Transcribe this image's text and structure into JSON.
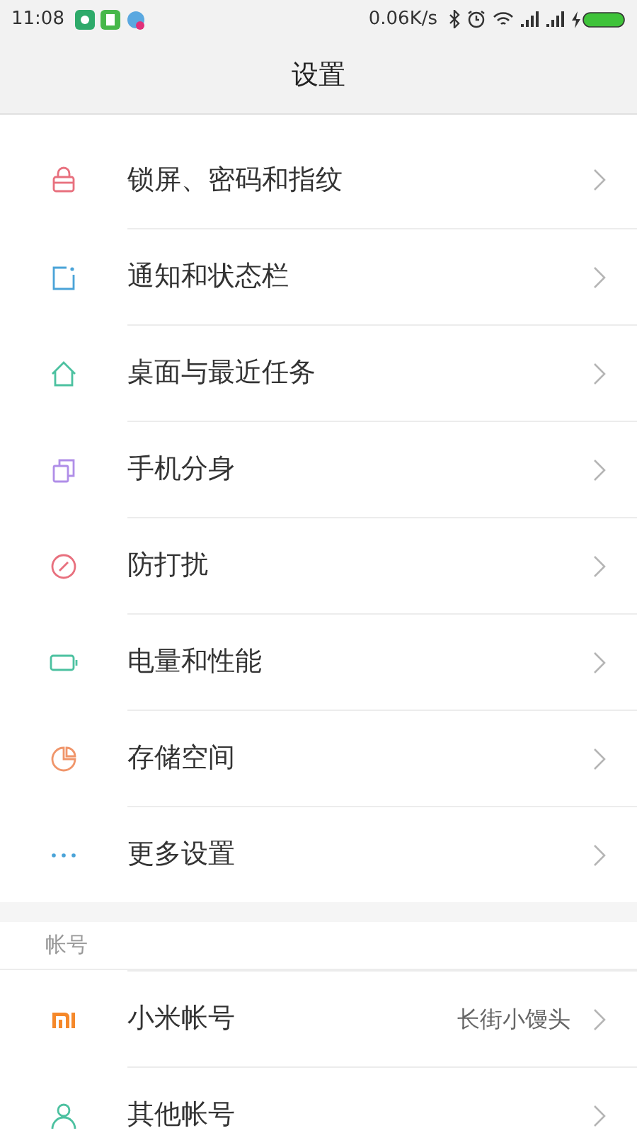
{
  "status_bar": {
    "time": "11:08",
    "speed": "0.06K/s"
  },
  "title": "设置",
  "sections": [
    {
      "items": [
        {
          "kind": "lock",
          "color": "#e8707e",
          "label": "锁屏、密码和指纹"
        },
        {
          "kind": "notify",
          "color": "#4aa3d8",
          "label": "通知和状态栏"
        },
        {
          "kind": "home",
          "color": "#4cc1a0",
          "label": "桌面与最近任务"
        },
        {
          "kind": "clone",
          "color": "#b08ee8",
          "label": "手机分身"
        },
        {
          "kind": "dnd",
          "color": "#e8707e",
          "label": "防打扰"
        },
        {
          "kind": "battery",
          "color": "#4cc1a0",
          "label": "电量和性能"
        },
        {
          "kind": "storage",
          "color": "#f0956a",
          "label": "存储空间"
        },
        {
          "kind": "more",
          "color": "#4aa3d8",
          "label": "更多设置"
        }
      ]
    },
    {
      "header": "帐号",
      "items": [
        {
          "kind": "mi",
          "color": "#f5882a",
          "label": "小米帐号",
          "value": "长街小馒头"
        },
        {
          "kind": "person",
          "color": "#4cc1a0",
          "label": "其他帐号"
        }
      ]
    }
  ]
}
